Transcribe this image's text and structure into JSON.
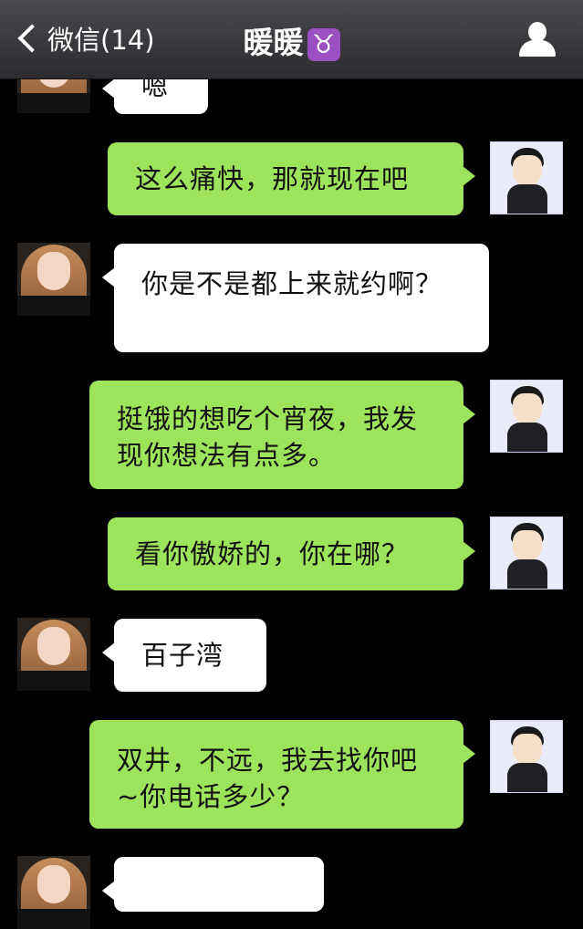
{
  "header": {
    "back_label": "微信(14)",
    "title": "暖暖",
    "zodiac_symbol": "♉"
  },
  "messages": [
    {
      "side": "in",
      "text": "嗯"
    },
    {
      "side": "out",
      "text": "这么痛快，那就现在吧"
    },
    {
      "side": "in",
      "text": "你是不是都上来就约啊？"
    },
    {
      "side": "out",
      "line1": "挺饿的想吃个宵夜，我发",
      "line2": "现你想法有点多。"
    },
    {
      "side": "out",
      "text": "看你傲娇的，你在哪？"
    },
    {
      "side": "in",
      "text": "百子湾"
    },
    {
      "side": "out",
      "line1": "双井，不远，我去找你吧",
      "line2": "~你电话多少？"
    },
    {
      "side": "in",
      "text": ""
    }
  ],
  "colors": {
    "background": "#000000",
    "incoming_bubble": "#ffffff",
    "outgoing_bubble": "#9ee35c",
    "zodiac_badge": "#9c4fc1"
  }
}
